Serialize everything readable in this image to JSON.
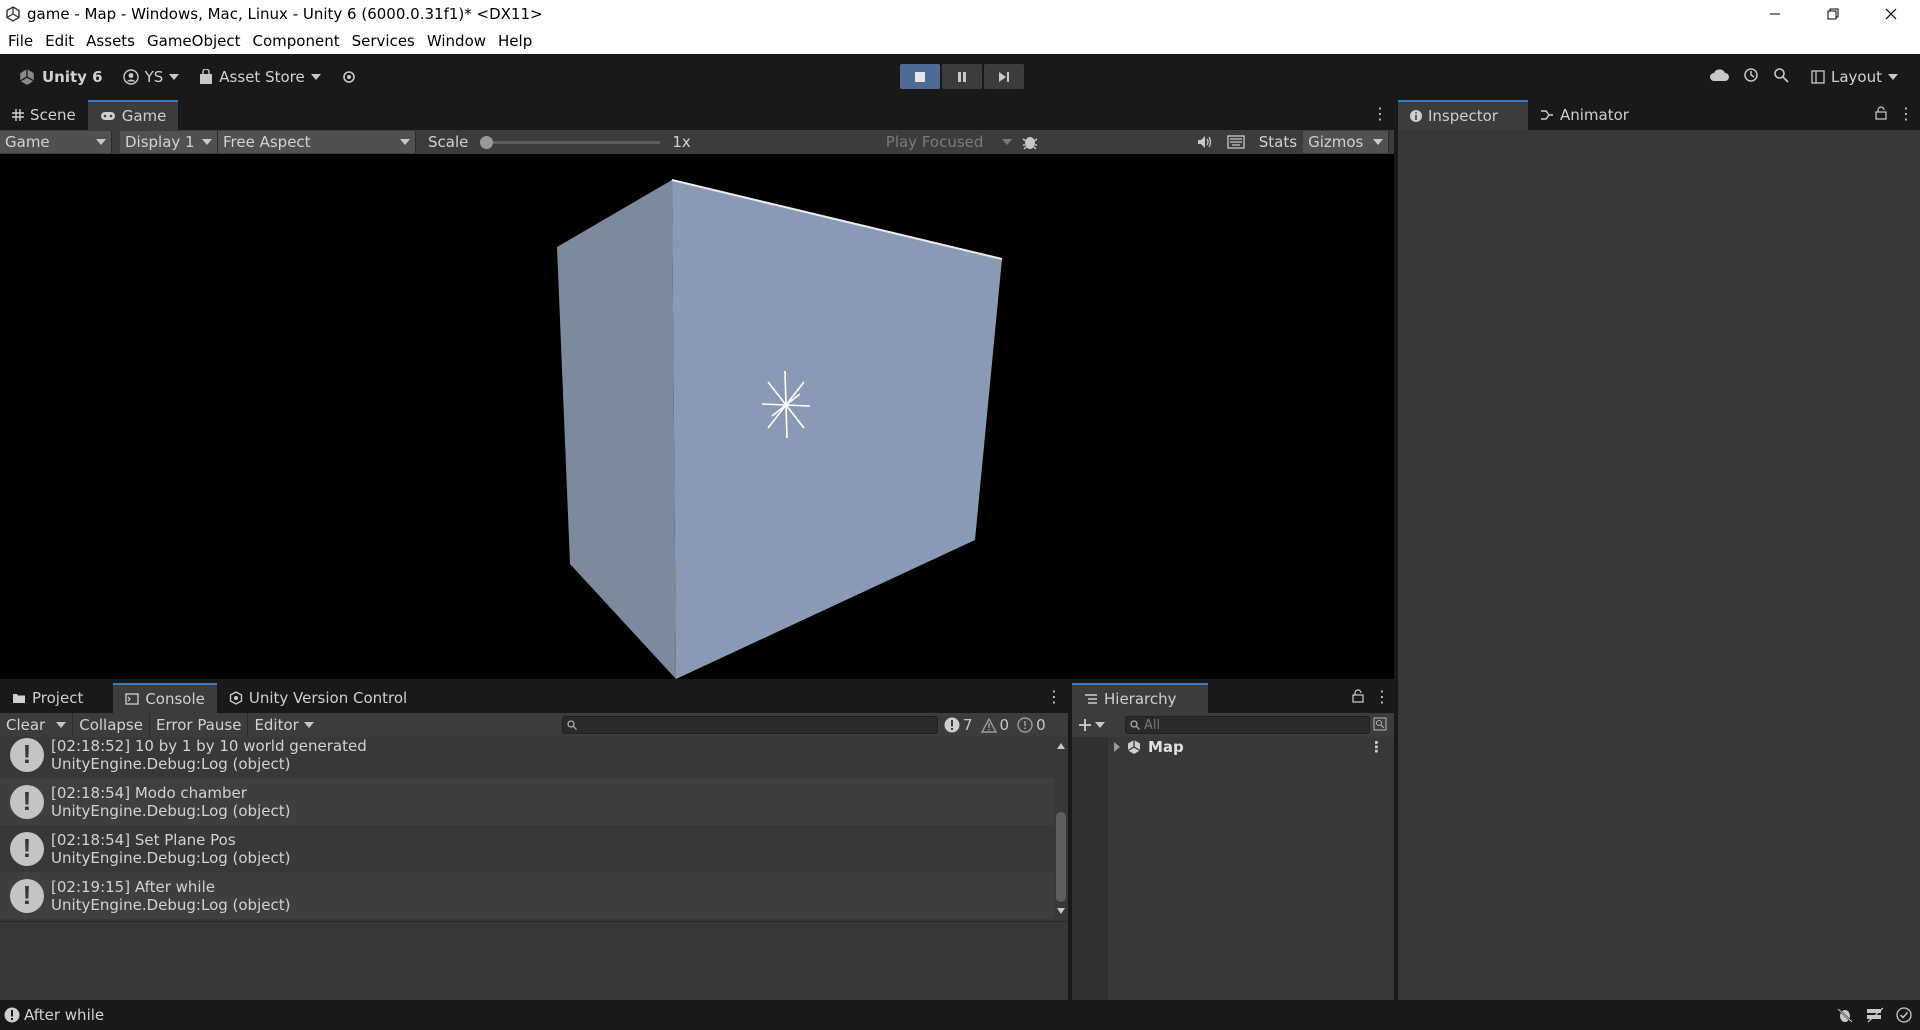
{
  "window": {
    "title": "game - Map - Windows, Mac, Linux - Unity 6 (6000.0.31f1)* <DX11>",
    "minimize_icon": "minimize-icon",
    "maximize_icon": "restore-icon",
    "close_icon": "close-icon"
  },
  "menu": [
    "File",
    "Edit",
    "Assets",
    "GameObject",
    "Component",
    "Services",
    "Window",
    "Help"
  ],
  "toolbar": {
    "unity_label": "Unity 6",
    "account_label": "YS",
    "asset_store_label": "Asset Store",
    "layout_label": "Layout"
  },
  "game_panel": {
    "tabs": [
      {
        "label": "Scene",
        "active": false
      },
      {
        "label": "Game",
        "active": true
      }
    ],
    "mode": "Game",
    "display": "Display 1",
    "aspect": "Free Aspect",
    "scale_label": "Scale",
    "scale_value": "1x",
    "play_focused": "Play Focused",
    "stats": "Stats",
    "gizmos": "Gizmos"
  },
  "inspector_panel": {
    "tabs": [
      {
        "label": "Inspector",
        "active": true
      },
      {
        "label": "Animator",
        "active": false
      }
    ]
  },
  "console_panel": {
    "tabs": [
      {
        "label": "Project",
        "active": false
      },
      {
        "label": "Console",
        "active": true
      },
      {
        "label": "Unity Version Control",
        "active": false
      }
    ],
    "clear": "Clear",
    "collapse": "Collapse",
    "error_pause": "Error Pause",
    "editor": "Editor",
    "log_count": "7",
    "warning_count": "0",
    "error_count": "0",
    "logs": [
      {
        "message": "[02:18:52] 10 by 1 by 10 world generated",
        "source": "UnityEngine.Debug:Log (object)"
      },
      {
        "message": "[02:18:54] Modo chamber",
        "source": "UnityEngine.Debug:Log (object)"
      },
      {
        "message": "[02:18:54] Set Plane Pos",
        "source": "UnityEngine.Debug:Log (object)"
      },
      {
        "message": "[02:19:15] After while",
        "source": "UnityEngine.Debug:Log (object)"
      }
    ]
  },
  "hierarchy_panel": {
    "tab": "Hierarchy",
    "search_placeholder": "All",
    "items": [
      {
        "label": "Map"
      }
    ]
  },
  "status": {
    "message": "After while"
  },
  "colors": {
    "accent": "#3a79bb",
    "play_active": "#4d6b95",
    "cube_face_left": "#7c889c",
    "cube_face_right": "#8c9bb5"
  }
}
